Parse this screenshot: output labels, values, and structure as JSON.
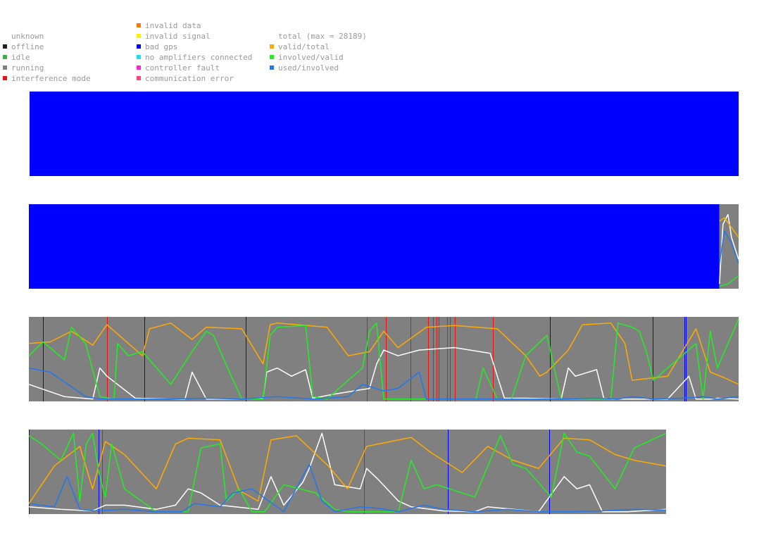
{
  "legend": {
    "status": [
      {
        "label": "unknown",
        "color": "#ffffff"
      },
      {
        "label": "offline",
        "color": "#202020"
      },
      {
        "label": "idle",
        "color": "#3cb043"
      },
      {
        "label": "running",
        "color": "#808080"
      },
      {
        "label": "interference mode",
        "color": "#ee1111"
      }
    ],
    "errors": [
      {
        "label": "invalid data",
        "color": "#ff7700"
      },
      {
        "label": "invalid signal",
        "color": "#ffee00"
      },
      {
        "label": "bad gps",
        "color": "#0000ff"
      },
      {
        "label": "no amplifiers connected",
        "color": "#22ddee"
      },
      {
        "label": "controller fault",
        "color": "#ff22cc"
      },
      {
        "label": "communication error",
        "color": "#ff4477"
      }
    ],
    "metrics": [
      {
        "label": "total (max = 28189)",
        "color": "#ffffff"
      },
      {
        "label": "valid/total",
        "color": "#ffaa00"
      },
      {
        "label": "involved/valid",
        "color": "#22ee22"
      },
      {
        "label": "used/involved",
        "color": "#2277ee"
      }
    ]
  },
  "chart_data": [
    {
      "type": "area",
      "panel": 1,
      "status_segments": [
        {
          "from": 0,
          "to": 1,
          "status": "bad gps"
        }
      ],
      "series": []
    },
    {
      "type": "line",
      "panel": 2,
      "status_segments": [
        {
          "from": 0,
          "to": 0.973,
          "status": "bad gps"
        },
        {
          "from": 0.973,
          "to": 1,
          "status": "running"
        }
      ],
      "series": [
        {
          "name": "total",
          "x": [
            0.973,
            0.978,
            0.985,
            0.99,
            1.0
          ],
          "y": [
            0.05,
            0.78,
            0.9,
            0.62,
            0.35
          ]
        },
        {
          "name": "valid/total",
          "x": [
            0.973,
            0.98,
            1.0
          ],
          "y": [
            0.82,
            0.86,
            0.62
          ]
        },
        {
          "name": "involved/valid",
          "x": [
            0.973,
            0.985,
            1.0
          ],
          "y": [
            0.02,
            0.05,
            0.15
          ]
        },
        {
          "name": "used/involved",
          "x": [
            0.973,
            0.98,
            0.99,
            1.0
          ],
          "y": [
            0.3,
            0.7,
            0.55,
            0.3
          ]
        }
      ]
    },
    {
      "type": "line",
      "panel": 3,
      "status_segments": [
        {
          "from": 0,
          "to": 1,
          "status": "running"
        }
      ],
      "marker_lines": [
        {
          "x": 0.02,
          "status": "bad gps"
        },
        {
          "x": 0.11,
          "status": "interference mode"
        },
        {
          "x": 0.163,
          "status": "bad gps"
        },
        {
          "x": 0.306,
          "status": "bad gps"
        },
        {
          "x": 0.477,
          "status": "interference mode"
        },
        {
          "x": 0.503,
          "status": "interference mode"
        },
        {
          "x": 0.538,
          "status": "interference mode"
        },
        {
          "x": 0.563,
          "status": "interference mode"
        },
        {
          "x": 0.57,
          "status": "interference mode"
        },
        {
          "x": 0.575,
          "status": "interference mode"
        },
        {
          "x": 0.578,
          "status": "interference mode"
        },
        {
          "x": 0.59,
          "status": "interference mode"
        },
        {
          "x": 0.594,
          "status": "interference mode"
        },
        {
          "x": 0.601,
          "status": "interference mode"
        },
        {
          "x": 0.654,
          "status": "interference mode"
        },
        {
          "x": 0.735,
          "status": "bad gps"
        },
        {
          "x": 0.88,
          "status": "bad gps"
        },
        {
          "x": 0.925,
          "status": "bad gps"
        },
        {
          "x": 0.927,
          "status": "bad gps"
        }
      ],
      "series": [
        {
          "name": "total",
          "x": [
            0,
            0.05,
            0.09,
            0.1,
            0.11,
            0.15,
            0.2,
            0.22,
            0.23,
            0.25,
            0.3,
            0.33,
            0.335,
            0.35,
            0.37,
            0.39,
            0.4,
            0.43,
            0.48,
            0.49,
            0.5,
            0.52,
            0.55,
            0.6,
            0.65,
            0.66,
            0.67,
            0.7,
            0.75,
            0.76,
            0.77,
            0.8,
            0.81,
            0.82,
            0.85,
            0.9,
            0.93,
            0.94,
            0.96,
            0.97,
            1.0
          ],
          "y": [
            0.2,
            0.05,
            0.02,
            0.4,
            0.3,
            0.03,
            0.02,
            0.02,
            0.35,
            0.02,
            0.02,
            0.03,
            0.35,
            0.4,
            0.3,
            0.38,
            0.03,
            0.08,
            0.15,
            0.45,
            0.62,
            0.55,
            0.62,
            0.65,
            0.58,
            0.3,
            0.03,
            0.03,
            0.02,
            0.4,
            0.3,
            0.38,
            0.03,
            0.02,
            0.02,
            0.02,
            0.3,
            0.02,
            0.02,
            0.03,
            0.02
          ]
        },
        {
          "name": "valid/total",
          "x": [
            0,
            0.03,
            0.06,
            0.09,
            0.11,
            0.16,
            0.17,
            0.2,
            0.23,
            0.25,
            0.3,
            0.33,
            0.34,
            0.35,
            0.42,
            0.45,
            0.48,
            0.5,
            0.52,
            0.56,
            0.6,
            0.66,
            0.7,
            0.72,
            0.73,
            0.76,
            0.78,
            0.82,
            0.84,
            0.85,
            0.9,
            0.94,
            0.96,
            0.98,
            1.0
          ],
          "y": [
            0.7,
            0.72,
            0.85,
            0.68,
            0.93,
            0.55,
            0.88,
            0.95,
            0.75,
            0.9,
            0.88,
            0.45,
            0.93,
            0.95,
            0.9,
            0.55,
            0.6,
            0.85,
            0.65,
            0.9,
            0.92,
            0.88,
            0.55,
            0.3,
            0.35,
            0.62,
            0.93,
            0.95,
            0.7,
            0.25,
            0.3,
            0.88,
            0.35,
            0.28,
            0.2
          ]
        },
        {
          "name": "involved/valid",
          "x": [
            0,
            0.02,
            0.05,
            0.06,
            0.08,
            0.1,
            0.12,
            0.125,
            0.14,
            0.16,
            0.2,
            0.23,
            0.25,
            0.26,
            0.28,
            0.3,
            0.33,
            0.34,
            0.35,
            0.39,
            0.4,
            0.42,
            0.45,
            0.47,
            0.48,
            0.49,
            0.5,
            0.52,
            0.6,
            0.63,
            0.64,
            0.66,
            0.68,
            0.7,
            0.73,
            0.75,
            0.76,
            0.8,
            0.82,
            0.83,
            0.85,
            0.86,
            0.87,
            0.88,
            0.92,
            0.94,
            0.95,
            0.96,
            0.97,
            1.0
          ],
          "y": [
            0.55,
            0.72,
            0.5,
            0.9,
            0.7,
            0.05,
            0.02,
            0.7,
            0.55,
            0.6,
            0.2,
            0.6,
            0.85,
            0.8,
            0.4,
            0.02,
            0.02,
            0.8,
            0.9,
            0.92,
            0.05,
            0.02,
            0.25,
            0.4,
            0.85,
            0.95,
            0.02,
            0.02,
            0.02,
            0.02,
            0.4,
            0.02,
            0.02,
            0.55,
            0.8,
            0.02,
            0.02,
            0.02,
            0.02,
            0.95,
            0.9,
            0.85,
            0.6,
            0.25,
            0.55,
            0.7,
            0.02,
            0.85,
            0.4,
            1.0
          ]
        },
        {
          "name": "used/involved",
          "x": [
            0,
            0.03,
            0.08,
            0.1,
            0.2,
            0.25,
            0.3,
            0.35,
            0.4,
            0.45,
            0.47,
            0.5,
            0.52,
            0.55,
            0.56,
            0.6,
            0.65,
            0.75,
            0.8,
            0.83,
            0.85,
            0.88,
            0.92,
            0.95,
            0.97,
            1.0
          ],
          "y": [
            0.4,
            0.35,
            0.05,
            0.02,
            0.02,
            0.03,
            0.02,
            0.05,
            0.02,
            0.05,
            0.2,
            0.12,
            0.15,
            0.35,
            0.02,
            0.02,
            0.02,
            0.02,
            0.03,
            0.02,
            0.05,
            0.02,
            0.03,
            0.05,
            0.02,
            0.05
          ]
        }
      ]
    },
    {
      "type": "line",
      "panel": 4,
      "status_segments": [
        {
          "from": 0,
          "to": 1,
          "status": "running"
        }
      ],
      "marker_lines": [
        {
          "x": 0.0,
          "status": "bad gps"
        },
        {
          "x": 0.11,
          "status": "bad gps"
        },
        {
          "x": 0.115,
          "status": "interference mode"
        },
        {
          "x": 0.527,
          "status": "interference mode"
        },
        {
          "x": 0.658,
          "status": "bad gps"
        },
        {
          "x": 0.818,
          "status": "bad gps"
        }
      ],
      "series": [
        {
          "name": "total",
          "x": [
            0,
            0.05,
            0.1,
            0.12,
            0.15,
            0.2,
            0.23,
            0.25,
            0.27,
            0.3,
            0.36,
            0.38,
            0.4,
            0.43,
            0.44,
            0.46,
            0.48,
            0.52,
            0.53,
            0.55,
            0.58,
            0.6,
            0.65,
            0.7,
            0.72,
            0.8,
            0.84,
            0.86,
            0.88,
            0.9,
            0.94,
            1.0
          ],
          "y": [
            0.08,
            0.05,
            0.03,
            0.1,
            0.1,
            0.05,
            0.1,
            0.3,
            0.25,
            0.1,
            0.05,
            0.45,
            0.1,
            0.38,
            0.55,
            0.98,
            0.35,
            0.3,
            0.55,
            0.4,
            0.15,
            0.08,
            0.03,
            0.02,
            0.08,
            0.02,
            0.45,
            0.3,
            0.35,
            0.02,
            0.02,
            0.05
          ]
        },
        {
          "name": "valid/total",
          "x": [
            0,
            0.04,
            0.08,
            0.1,
            0.12,
            0.15,
            0.2,
            0.23,
            0.25,
            0.3,
            0.33,
            0.36,
            0.38,
            0.42,
            0.47,
            0.5,
            0.53,
            0.6,
            0.63,
            0.65,
            0.68,
            0.72,
            0.76,
            0.8,
            0.84,
            0.88,
            0.92,
            0.95,
            1.0
          ],
          "y": [
            0.12,
            0.58,
            0.82,
            0.3,
            0.88,
            0.72,
            0.3,
            0.85,
            0.92,
            0.9,
            0.28,
            0.15,
            0.9,
            0.95,
            0.58,
            0.3,
            0.82,
            0.93,
            0.75,
            0.65,
            0.5,
            0.82,
            0.65,
            0.55,
            0.92,
            0.9,
            0.72,
            0.65,
            0.58
          ]
        },
        {
          "name": "involved/valid",
          "x": [
            0,
            0.02,
            0.05,
            0.07,
            0.08,
            0.09,
            0.1,
            0.11,
            0.12,
            0.13,
            0.15,
            0.2,
            0.25,
            0.27,
            0.3,
            0.31,
            0.33,
            0.35,
            0.37,
            0.4,
            0.45,
            0.48,
            0.5,
            0.55,
            0.58,
            0.6,
            0.62,
            0.64,
            0.7,
            0.74,
            0.76,
            0.78,
            0.82,
            0.84,
            0.86,
            0.88,
            0.9,
            0.92,
            0.95,
            1.0
          ],
          "y": [
            0.95,
            0.85,
            0.65,
            0.98,
            0.15,
            0.85,
            0.98,
            0.5,
            0.2,
            0.85,
            0.3,
            0.02,
            0.02,
            0.8,
            0.85,
            0.15,
            0.3,
            0.02,
            0.02,
            0.35,
            0.25,
            0.05,
            0.02,
            0.02,
            0.02,
            0.65,
            0.3,
            0.35,
            0.2,
            0.95,
            0.6,
            0.55,
            0.2,
            0.98,
            0.75,
            0.7,
            0.5,
            0.3,
            0.8,
            0.98
          ]
        },
        {
          "name": "used/involved",
          "x": [
            0,
            0.04,
            0.06,
            0.08,
            0.1,
            0.15,
            0.2,
            0.24,
            0.26,
            0.3,
            0.32,
            0.35,
            0.4,
            0.44,
            0.46,
            0.48,
            0.52,
            0.55,
            0.58,
            0.6,
            0.62,
            0.65,
            0.7,
            0.75,
            0.8,
            0.85,
            0.9,
            0.95,
            1.0
          ],
          "y": [
            0.12,
            0.08,
            0.45,
            0.05,
            0.03,
            0.05,
            0.02,
            0.02,
            0.12,
            0.08,
            0.25,
            0.3,
            0.02,
            0.6,
            0.15,
            0.02,
            0.08,
            0.06,
            0.02,
            0.06,
            0.1,
            0.05,
            0.02,
            0.05,
            0.02,
            0.02,
            0.03,
            0.05,
            0.04
          ]
        }
      ]
    }
  ]
}
